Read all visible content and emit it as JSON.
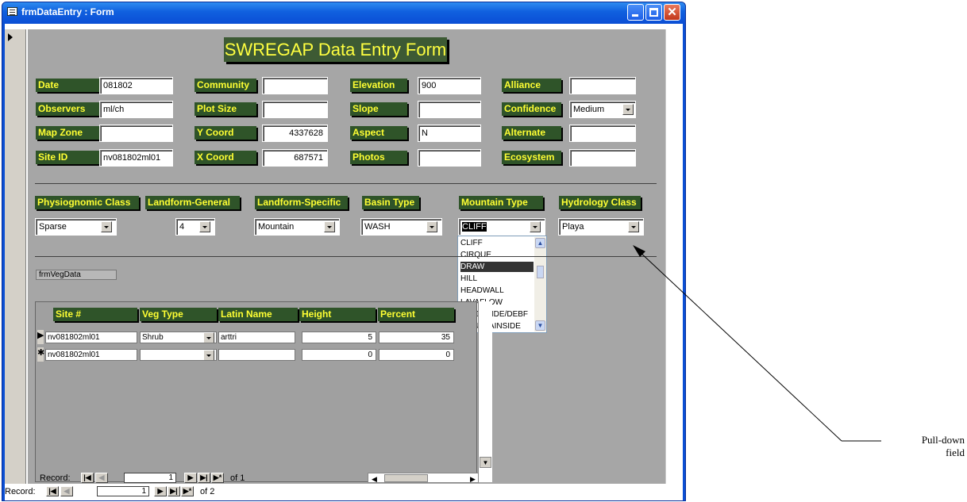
{
  "window": {
    "title": "frmDataEntry : Form"
  },
  "form": {
    "title": "SWREGAP Data Entry Form",
    "fields": [
      {
        "label": "Date",
        "value": "081802",
        "align": "left"
      },
      {
        "label": "Observers",
        "value": "ml/ch",
        "align": "left"
      },
      {
        "label": "Map Zone",
        "value": "",
        "align": "left"
      },
      {
        "label": "Site ID",
        "value": "nv081802ml01",
        "align": "left"
      },
      {
        "label": "Community",
        "value": "",
        "align": "left"
      },
      {
        "label": "Plot Size",
        "value": "",
        "align": "left"
      },
      {
        "label": "Y Coord",
        "value": "4337628",
        "align": "right"
      },
      {
        "label": "X Coord",
        "value": "687571",
        "align": "right"
      },
      {
        "label": "Elevation",
        "value": "900",
        "align": "left"
      },
      {
        "label": "Slope",
        "value": "",
        "align": "left"
      },
      {
        "label": "Aspect",
        "value": "N",
        "align": "left"
      },
      {
        "label": "Photos",
        "value": "",
        "align": "left"
      },
      {
        "label": "Alliance",
        "value": "",
        "align": "left"
      },
      {
        "label": "Confidence",
        "value": "Medium",
        "align": "left"
      },
      {
        "label": "Alternate",
        "value": "",
        "align": "left"
      },
      {
        "label": "Ecosystem",
        "value": "",
        "align": "left"
      }
    ],
    "class_fields": [
      {
        "label": "Physiognomic Class",
        "value": "Sparse"
      },
      {
        "label": "Landform-General",
        "value": "4"
      },
      {
        "label": "Landform-Specific",
        "value": "Mountain"
      },
      {
        "label": "Basin Type",
        "value": "WASH"
      },
      {
        "label": "Mountain Type",
        "value": "CLIFF"
      },
      {
        "label": "Hydrology Class",
        "value": "Playa"
      }
    ],
    "mountain_type_options": [
      "CLIFF",
      "CIRQUE",
      "DRAW",
      "HILL",
      "HEADWALL",
      "LAVAFLOW",
      "LANDSLIDE/DEBF",
      "MOUNTAINSIDE"
    ],
    "mountain_type_highlighted": "DRAW"
  },
  "subform": {
    "name": "frmVegData",
    "columns": [
      "Site #",
      "Veg Type",
      "Latin Name",
      "Height",
      "Percent"
    ],
    "rows": [
      {
        "marker": "▶",
        "site": "nv081802ml01",
        "veg_type": "Shrub",
        "latin": "arttri",
        "height": "5",
        "percent": "35"
      },
      {
        "marker": "✱",
        "site": "nv081802ml01",
        "veg_type": "",
        "latin": "",
        "height": "0",
        "percent": "0"
      }
    ],
    "nav": {
      "label": "Record:",
      "current": "1",
      "of_text": "of 1"
    }
  },
  "main_nav": {
    "label": "Record:",
    "current": "1",
    "of_text": "of 2"
  },
  "annotation": {
    "line1": "Pull-down",
    "line2": "field"
  },
  "colors": {
    "label_bg": "#2f5429",
    "label_text": "#ffff33",
    "form_bg": "#a6a6a6",
    "title_bar": "#0b4fd6"
  }
}
